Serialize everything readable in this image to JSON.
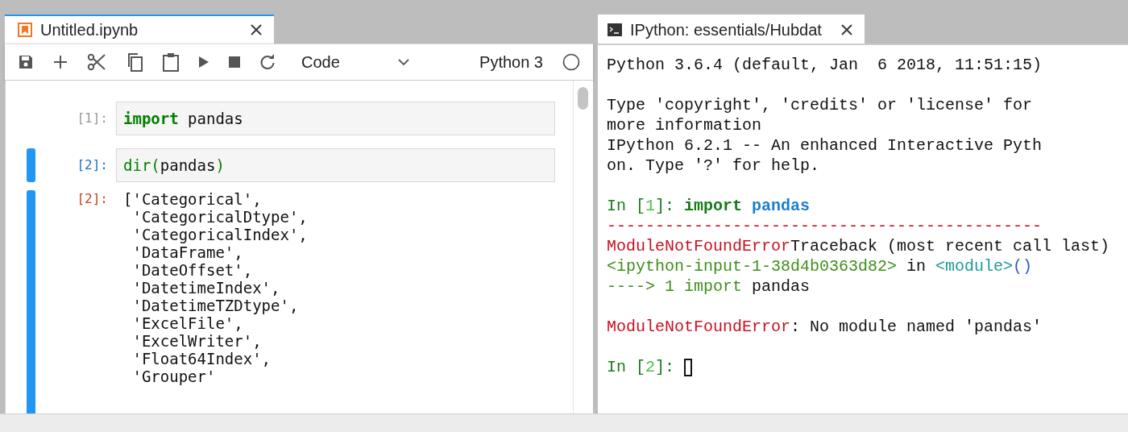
{
  "notebook": {
    "tab": {
      "title": "Untitled.ipynb",
      "selected": true
    },
    "toolbar": {
      "cell_type": "Code",
      "kernel": "Python 3"
    },
    "cells": [
      {
        "kind": "input",
        "prompt": "[1]:",
        "selected": false,
        "code": [
          {
            "text": "import",
            "kind": "keyword"
          },
          {
            "text": " pandas",
            "kind": "plain"
          }
        ]
      },
      {
        "kind": "input",
        "prompt": "[2]:",
        "selected": true,
        "code": [
          {
            "text": "dir",
            "kind": "builtin"
          },
          {
            "text": "(",
            "kind": "paren"
          },
          {
            "text": "pandas",
            "kind": "plain"
          },
          {
            "text": ")",
            "kind": "paren"
          }
        ]
      },
      {
        "kind": "output",
        "prompt": "[2]:",
        "selected": true,
        "lines": [
          "['Categorical',",
          " 'CategoricalDtype',",
          " 'CategoricalIndex',",
          " 'DataFrame',",
          " 'DateOffset',",
          " 'DatetimeIndex',",
          " 'DatetimeTZDtype',",
          " 'ExcelFile',",
          " 'ExcelWriter',",
          " 'Float64Index',",
          " 'Grouper'"
        ]
      }
    ]
  },
  "terminal": {
    "tab": {
      "title": "IPython: essentials/Hubdat",
      "selected": false
    },
    "blocks": [
      [
        {
          "cursor": false,
          "segments": [
            {
              "text": "Python 3.6.4 (default, Jan  6 2018, 11:51:15)",
              "kind": "plain"
            }
          ]
        }
      ],
      [
        {
          "cursor": false,
          "segments": [
            {
              "text": "Type 'copyright', 'credits' or 'license' for",
              "kind": "plain"
            }
          ]
        },
        {
          "cursor": false,
          "segments": [
            {
              "text": "more information",
              "kind": "plain"
            }
          ]
        },
        {
          "cursor": false,
          "segments": [
            {
              "text": "IPython 6.2.1 -- An enhanced Interactive Pyth",
              "kind": "plain"
            }
          ]
        },
        {
          "cursor": false,
          "segments": [
            {
              "text": "on. Type '?' for help.",
              "kind": "plain"
            }
          ]
        }
      ],
      [
        {
          "cursor": false,
          "segments": [
            {
              "text": "In [",
              "kind": "prompt"
            },
            {
              "text": "1",
              "kind": "number"
            },
            {
              "text": "]: ",
              "kind": "prompt"
            },
            {
              "text": "import",
              "kind": "keyword"
            },
            {
              "text": " pandas",
              "kind": "name"
            }
          ]
        },
        {
          "cursor": false,
          "segments": [
            {
              "text": "---------------------------------------------",
              "kind": "error"
            }
          ]
        },
        {
          "cursor": false,
          "segments": [
            {
              "text": "ModuleNotFoundError",
              "kind": "error"
            },
            {
              "text": "Traceback (most recent call last)",
              "kind": "plain"
            }
          ]
        },
        {
          "cursor": false,
          "segments": [
            {
              "text": "<ipython-input-1-38d4b0363d82>",
              "kind": "green"
            },
            {
              "text": " in ",
              "kind": "plain"
            },
            {
              "text": "<module>",
              "kind": "teal"
            },
            {
              "text": "()",
              "kind": "paren"
            }
          ]
        },
        {
          "cursor": false,
          "segments": [
            {
              "text": "----> 1 import",
              "kind": "green"
            },
            {
              "text": " pandas",
              "kind": "plain"
            }
          ]
        }
      ],
      [
        {
          "cursor": false,
          "segments": [
            {
              "text": "ModuleNotFoundError",
              "kind": "error"
            },
            {
              "text": ": No module named 'pandas'",
              "kind": "plain"
            }
          ]
        }
      ],
      [
        {
          "cursor": true,
          "segments": [
            {
              "text": "In [",
              "kind": "prompt"
            },
            {
              "text": "2",
              "kind": "number"
            },
            {
              "text": "]: ",
              "kind": "prompt"
            }
          ]
        }
      ]
    ]
  }
}
